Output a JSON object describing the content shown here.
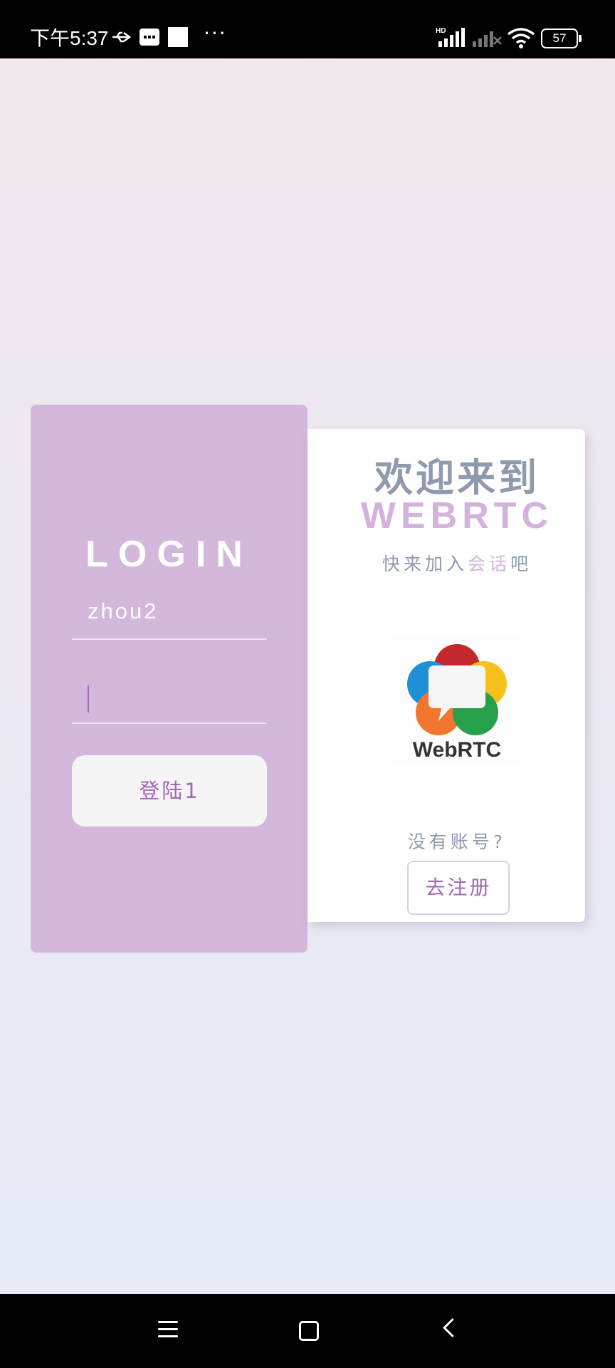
{
  "status_bar": {
    "time": "下午5:37",
    "dots": "···",
    "network": "HD",
    "battery": "57",
    "icons": [
      "usb-icon",
      "message-icon",
      "square-icon",
      "more-icon",
      "signal-icon",
      "signal-off-icon",
      "wifi-icon",
      "battery-icon"
    ]
  },
  "login": {
    "title": "LOGIN",
    "username_value": "zhou2",
    "password_value": "",
    "button_label": "登陆1"
  },
  "welcome": {
    "title": "欢迎来到",
    "brand": "WEBRTC",
    "subtitle_pre": "快来加入",
    "subtitle_accent": "会话",
    "subtitle_post": "吧",
    "logo_text": "WebRTC",
    "no_account": "没有账号?",
    "register_label": "去注册"
  },
  "colors": {
    "login_card": "#d3b8db",
    "accent_purple": "#a566b7",
    "text_gray": "#8f9aae",
    "brand_light": "#d3b3dc"
  },
  "nav_bar": {
    "icons": [
      "menu-icon",
      "home-icon",
      "back-icon"
    ]
  }
}
